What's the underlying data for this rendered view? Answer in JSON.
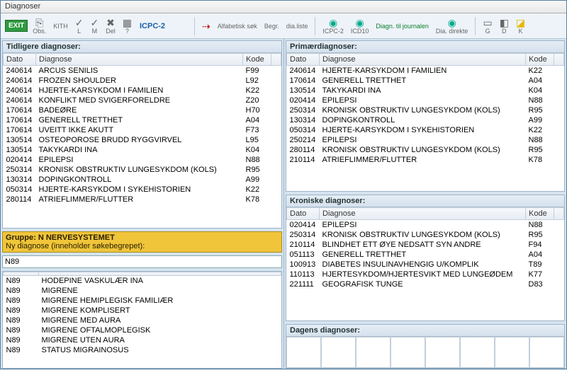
{
  "window": {
    "title": "Diagnoser"
  },
  "toolbar": {
    "exit": "EXIT",
    "icpc2_label": "ICPC-2",
    "items": [
      {
        "label": "Obs."
      },
      {
        "label": "L"
      },
      {
        "label": "M"
      },
      {
        "label": "Del"
      },
      {
        "label": "?"
      }
    ],
    "right_items": [
      {
        "label": "Alfabetisk søk"
      },
      {
        "label": "Begr."
      },
      {
        "label": "dia.liste"
      },
      {
        "label": "ICPC-2"
      },
      {
        "label": "ICD10"
      },
      {
        "label": "Diagn. til journalen"
      },
      {
        "label": "Dia. direkte"
      },
      {
        "label": "G"
      },
      {
        "label": "D"
      },
      {
        "label": "K"
      }
    ]
  },
  "panels": {
    "tidligere": "Tidligere diagnoser:",
    "primaer": "Primærdiagnoser:",
    "kroniske": "Kroniske diagnoser:",
    "dagens": "Dagens diagnoser:"
  },
  "headers": {
    "dato": "Dato",
    "diagnose": "Diagnose",
    "kode": "Kode"
  },
  "tidligere_rows": [
    {
      "dato": "240614",
      "diag": "ARCUS SENILIS",
      "kode": "F99"
    },
    {
      "dato": "240614",
      "diag": "FROZEN SHOULDER",
      "kode": "L92"
    },
    {
      "dato": "240614",
      "diag": "HJERTE-KARSYKDOM I FAMILIEN",
      "kode": "K22"
    },
    {
      "dato": "240614",
      "diag": "KONFLIKT MED SVIGERFORELDRE",
      "kode": "Z20"
    },
    {
      "dato": "170614",
      "diag": "BADEØRE",
      "kode": "H70"
    },
    {
      "dato": "170614",
      "diag": "GENERELL TRETTHET",
      "kode": "A04"
    },
    {
      "dato": "170614",
      "diag": "UVEITT IKKE AKUTT",
      "kode": "F73"
    },
    {
      "dato": "130514",
      "diag": "OSTEOPOROSE BRUDD RYGGVIRVEL",
      "kode": "L95"
    },
    {
      "dato": "130514",
      "diag": "TAKYKARDI INA",
      "kode": "K04"
    },
    {
      "dato": "020414",
      "diag": "EPILEPSI",
      "kode": "N88"
    },
    {
      "dato": "250314",
      "diag": "KRONISK OBSTRUKTIV LUNGESYKDOM (KOLS)",
      "kode": "R95"
    },
    {
      "dato": "130314",
      "diag": "DOPINGKONTROLL",
      "kode": "A99"
    },
    {
      "dato": "050314",
      "diag": "HJERTE-KARSYKDOM I SYKEHISTORIEN",
      "kode": "K22"
    },
    {
      "dato": "280114",
      "diag": "ATRIEFLIMMER/FLUTTER",
      "kode": "K78"
    }
  ],
  "primaer_rows": [
    {
      "dato": "240614",
      "diag": "HJERTE-KARSYKDOM I FAMILIEN",
      "kode": "K22"
    },
    {
      "dato": "170614",
      "diag": "GENERELL TRETTHET",
      "kode": "A04"
    },
    {
      "dato": "130514",
      "diag": "TAKYKARDI INA",
      "kode": "K04"
    },
    {
      "dato": "020414",
      "diag": "EPILEPSI",
      "kode": "N88"
    },
    {
      "dato": "250314",
      "diag": "KRONISK OBSTRUKTIV LUNGESYKDOM (KOLS)",
      "kode": "R95"
    },
    {
      "dato": "130314",
      "diag": "DOPINGKONTROLL",
      "kode": "A99"
    },
    {
      "dato": "050314",
      "diag": "HJERTE-KARSYKDOM I SYKEHISTORIEN",
      "kode": "K22"
    },
    {
      "dato": "250214",
      "diag": "EPILEPSI",
      "kode": "N88"
    },
    {
      "dato": "280114",
      "diag": "KRONISK OBSTRUKTIV LUNGESYKDOM (KOLS)",
      "kode": "R95"
    },
    {
      "dato": "210114",
      "diag": "ATRIEFLIMMER/FLUTTER",
      "kode": "K78"
    }
  ],
  "kroniske_rows": [
    {
      "dato": "020414",
      "diag": "EPILEPSI",
      "kode": "N88"
    },
    {
      "dato": "250314",
      "diag": "KRONISK OBSTRUKTIV LUNGESYKDOM (KOLS)",
      "kode": "R95"
    },
    {
      "dato": "210114",
      "diag": "BLINDHET ETT ØYE NEDSATT SYN ANDRE",
      "kode": "F94"
    },
    {
      "dato": "051113",
      "diag": "GENERELL TRETTHET",
      "kode": "A04"
    },
    {
      "dato": "100913",
      "diag": "DIABETES INSULINAVHENGIG U/KOMPLIK",
      "kode": "T89"
    },
    {
      "dato": "110113",
      "diag": "HJERTESYKDOM/HJERTESVIKT MED LUNGEØDEM",
      "kode": "K77"
    },
    {
      "dato": "221111",
      "diag": "GEOGRAFISK TUNGE",
      "kode": "D83"
    }
  ],
  "ny_diagnose": {
    "group_label": "Gruppe:  N  NERVESYSTEMET",
    "sub_label": "Ny diagnose (inneholder søkebegrepet):",
    "search_value": "N89",
    "rows": [
      {
        "code": "N89",
        "diag": "HODEPINE VASKULÆR INA"
      },
      {
        "code": "N89",
        "diag": "MIGRENE"
      },
      {
        "code": "N89",
        "diag": "MIGRENE HEMIPLEGISK FAMILIÆR"
      },
      {
        "code": "N89",
        "diag": "MIGRENE KOMPLISERT"
      },
      {
        "code": "N89",
        "diag": "MIGRENE MED AURA"
      },
      {
        "code": "N89",
        "diag": "MIGRENE OFTALMOPLEGISK"
      },
      {
        "code": "N89",
        "diag": "MIGRENE UTEN AURA"
      },
      {
        "code": "N89",
        "diag": "STATUS MIGRAINOSUS"
      }
    ]
  }
}
